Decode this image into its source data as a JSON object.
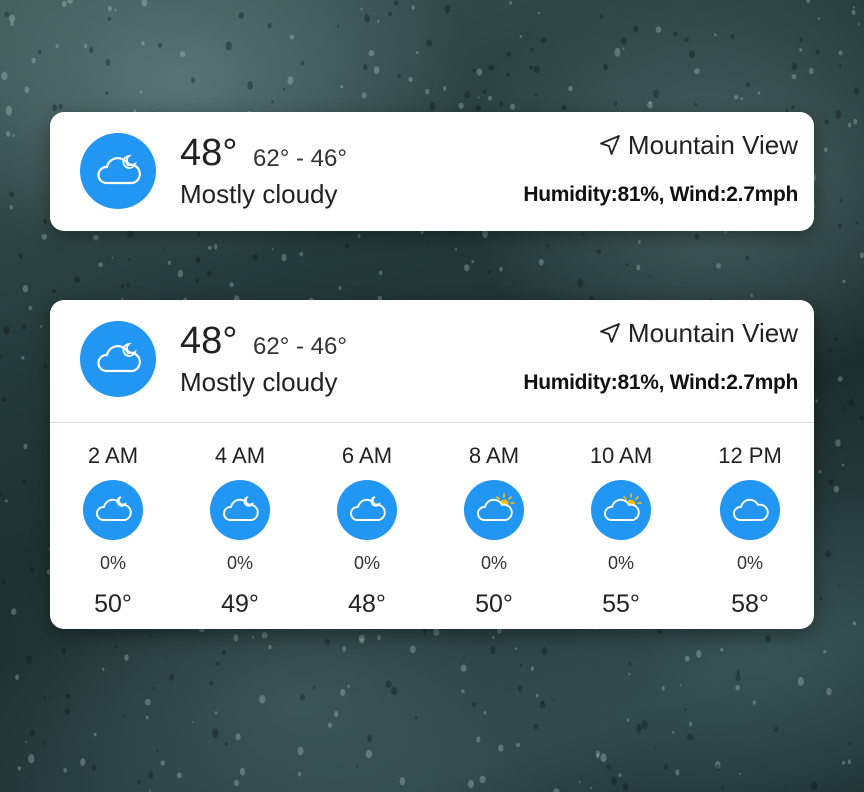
{
  "widget_compact": {
    "temp": "48°",
    "range": "62° - 46°",
    "condition": "Mostly cloudy",
    "location": "Mountain View",
    "details": "Humidity:81%, Wind:2.7mph",
    "icon": "cloud-moon-icon"
  },
  "widget_expanded": {
    "temp": "48°",
    "range": "62° - 46°",
    "condition": "Mostly cloudy",
    "location": "Mountain View",
    "details": "Humidity:81%, Wind:2.7mph",
    "icon": "cloud-moon-icon",
    "hourly": [
      {
        "time": "2 AM",
        "precip": "0%",
        "temp": "50°",
        "icon": "cloud-moon-icon"
      },
      {
        "time": "4 AM",
        "precip": "0%",
        "temp": "49°",
        "icon": "cloud-moon-icon"
      },
      {
        "time": "6 AM",
        "precip": "0%",
        "temp": "48°",
        "icon": "cloud-moon-icon"
      },
      {
        "time": "8 AM",
        "precip": "0%",
        "temp": "50°",
        "icon": "cloud-sun-icon"
      },
      {
        "time": "10 AM",
        "precip": "0%",
        "temp": "55°",
        "icon": "cloud-sun-icon"
      },
      {
        "time": "12 PM",
        "precip": "0%",
        "temp": "58°",
        "icon": "cloud-icon"
      }
    ]
  },
  "colors": {
    "icon_background": "#2196f3",
    "card": "#ffffff",
    "sun": "#ffc107"
  }
}
